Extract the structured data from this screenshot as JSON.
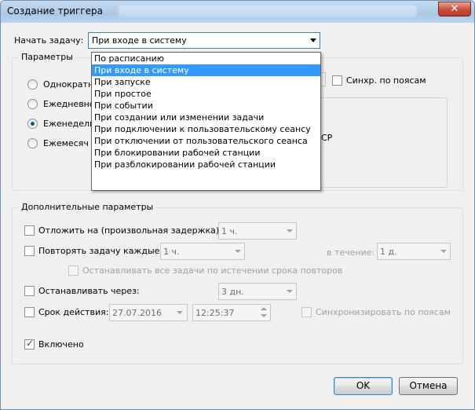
{
  "window": {
    "title": "Создание триггера",
    "close_glyph": "✕"
  },
  "start_task": {
    "label": "Начать задачу:",
    "value": "При входе в систему",
    "options": [
      "По расписанию",
      "При входе в систему",
      "При запуске",
      "При простое",
      "При событии",
      "При создании или изменении задачи",
      "При подключении к пользовательскому сеансу",
      "При отключении от пользовательского сеанса",
      "При блокировании рабочей станции",
      "При разблокировании рабочей станции"
    ],
    "selected_index": 1
  },
  "params": {
    "title": "Параметры",
    "radios": [
      {
        "label": "Однократн",
        "checked": false
      },
      {
        "label": "Ежедневно",
        "checked": false
      },
      {
        "label": "Еженедель",
        "checked": true
      },
      {
        "label": "Ежемесяч",
        "checked": false
      }
    ],
    "sync_label": "Синхр. по поясам",
    "fragment_cp": "СР"
  },
  "advanced": {
    "title": "Дополнительные параметры",
    "delay": {
      "label": "Отложить на (произвольная задержка):",
      "value": "1 ч.",
      "checked": false
    },
    "repeat": {
      "label": "Повторять задачу каждые:",
      "value": "1 ч.",
      "checked": false,
      "for_label": "в течение:",
      "for_value": "1 д."
    },
    "stop_all": {
      "label": "Останавливать все задачи по истечении срока повторов",
      "checked": false
    },
    "stop_after": {
      "label": "Останавливать через:",
      "value": "3 дн.",
      "checked": false
    },
    "expire": {
      "label": "Срок действия:",
      "date": "27.07.2016",
      "time": "12:25:37",
      "checked": false,
      "sync_label": "Синхронизировать по поясам"
    },
    "enabled": {
      "label": "Включено",
      "checked": true
    }
  },
  "buttons": {
    "ok": "OK",
    "cancel": "Отмена"
  }
}
